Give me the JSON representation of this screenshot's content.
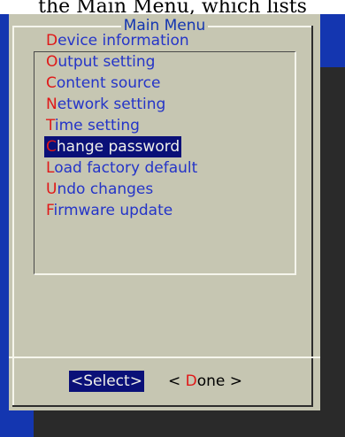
{
  "caption": "the Main Menu, which lists",
  "dialog": {
    "title": "Main Menu"
  },
  "menu": {
    "selected_index": 5,
    "items": [
      {
        "hotkey": "D",
        "rest": "evice information"
      },
      {
        "hotkey": "O",
        "rest": "utput setting"
      },
      {
        "hotkey": "C",
        "rest": "ontent source"
      },
      {
        "hotkey": "N",
        "rest": "etwork setting"
      },
      {
        "hotkey": "T",
        "rest": "ime setting"
      },
      {
        "hotkey": "C",
        "rest": "hange password"
      },
      {
        "hotkey": "L",
        "rest": "oad factory default"
      },
      {
        "hotkey": "U",
        "rest": "ndo changes"
      },
      {
        "hotkey": "F",
        "rest": "irmware update"
      }
    ]
  },
  "buttons": {
    "select": {
      "label": "<Select>"
    },
    "done": {
      "open": "< ",
      "hotkey": "D",
      "rest": "one >"
    }
  },
  "colors": {
    "screen_bg": "#1436b0",
    "dialog_bg": "#c6c6b2",
    "item_text": "#2434c8",
    "hotkey": "#e01818",
    "highlight_bg": "#0a1078",
    "highlight_text": "#f0f0ea"
  }
}
